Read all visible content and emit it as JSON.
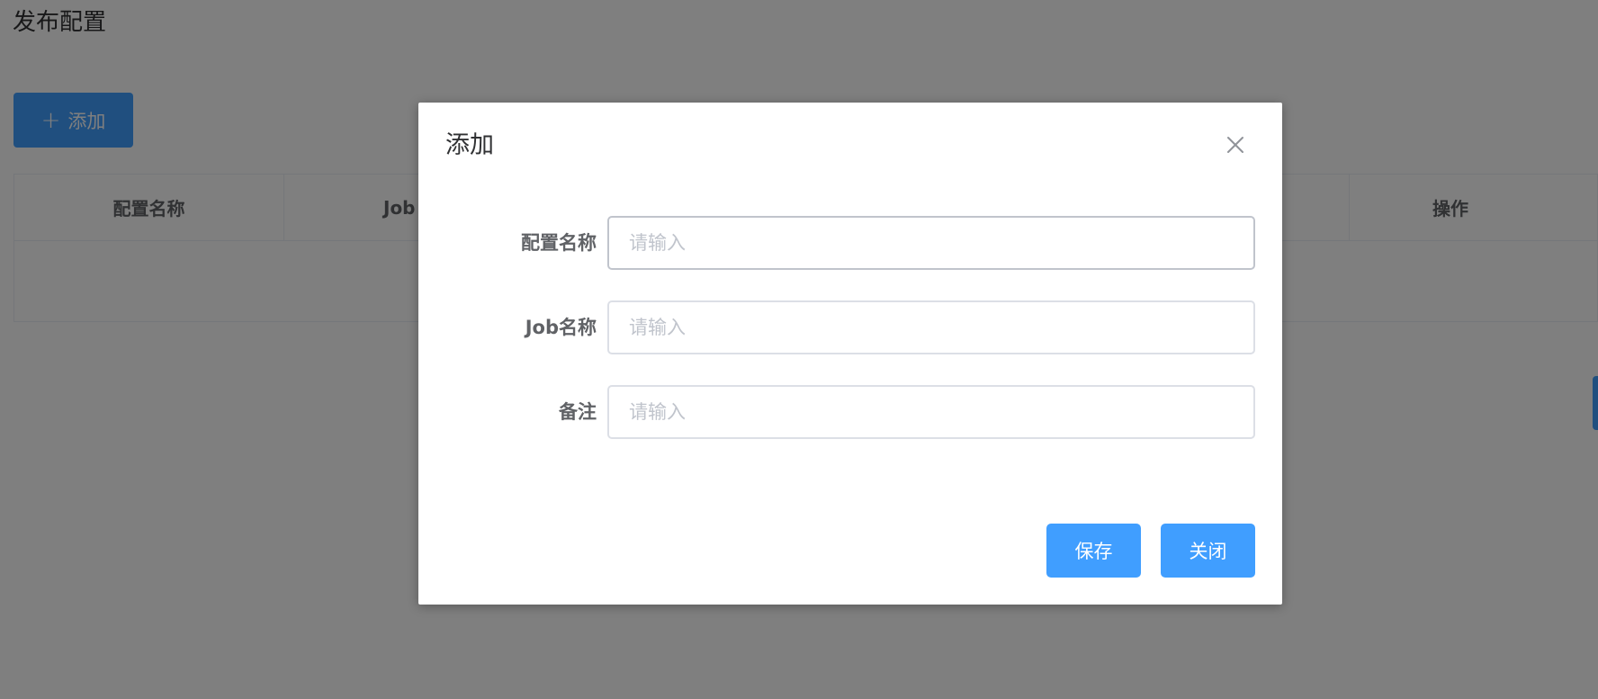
{
  "page": {
    "title": "发布配置",
    "add_button_label": "添加"
  },
  "table": {
    "columns": [
      "配置名称",
      "Job",
      "",
      "操作"
    ]
  },
  "dialog": {
    "title": "添加",
    "fields": [
      {
        "label": "配置名称",
        "value": "",
        "placeholder": "请输入"
      },
      {
        "label": "Job名称",
        "value": "",
        "placeholder": "请输入"
      },
      {
        "label": "备注",
        "value": "",
        "placeholder": "请输入"
      }
    ],
    "save_label": "保存",
    "close_label": "关闭"
  },
  "colors": {
    "primary": "#409eff",
    "overlay": "#808080",
    "label": "#606266",
    "placeholder": "#c0c4cc"
  },
  "icons": {
    "add": "plus-icon",
    "close": "close-icon"
  }
}
